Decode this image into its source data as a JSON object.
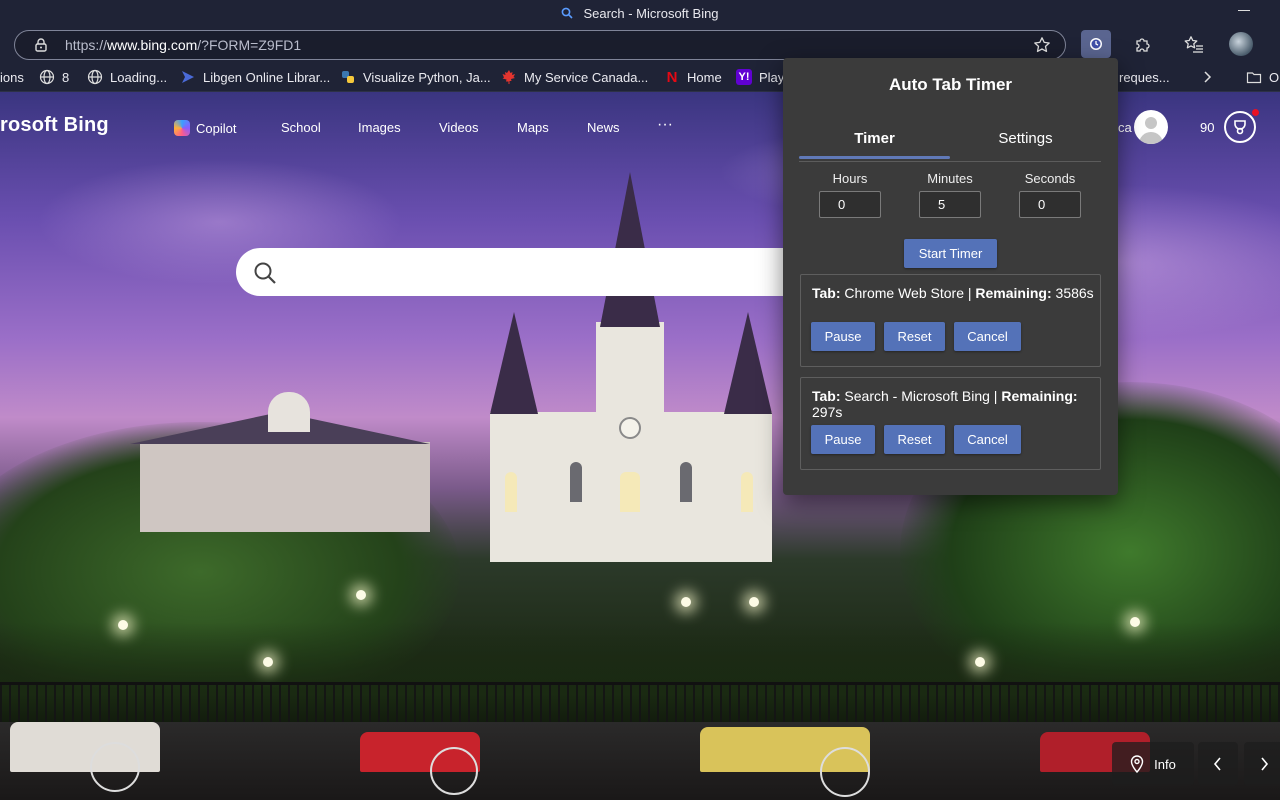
{
  "window": {
    "title": "Search - Microsoft Bing"
  },
  "address_bar": {
    "url_prefix": "https://",
    "url_host": "www.bing.com",
    "url_path": "/?FORM=Z9FD1"
  },
  "favorites": [
    {
      "label": "ions",
      "icon": ""
    },
    {
      "label": "8",
      "icon": "globe-icon"
    },
    {
      "label": "Loading...",
      "icon": "globe-icon"
    },
    {
      "label": "Libgen Online Librar...",
      "icon": "libgen-icon"
    },
    {
      "label": "Visualize Python, Ja...",
      "icon": "python-icon"
    },
    {
      "label": "My Service Canada...",
      "icon": "maple-leaf-icon"
    },
    {
      "label": "Home",
      "icon": "netflix-icon"
    },
    {
      "label": "Playe",
      "icon": "yahoo-icon"
    },
    {
      "label": "reques...",
      "icon": ""
    },
    {
      "label": "O",
      "icon": "folder-icon"
    }
  ],
  "bing": {
    "logo": "rosoft Bing",
    "nav": [
      "Copilot",
      "School",
      "Images",
      "Videos",
      "Maps",
      "News",
      "···"
    ],
    "user_name_fragment": "ca",
    "rewards_points": "90",
    "info_label": "Info"
  },
  "popup": {
    "title": "Auto Tab Timer",
    "tabs": [
      "Timer",
      "Settings"
    ],
    "fields": {
      "hours": {
        "label": "Hours",
        "value": "0"
      },
      "minutes": {
        "label": "Minutes",
        "value": "5"
      },
      "seconds": {
        "label": "Seconds",
        "value": "0"
      }
    },
    "start_label": "Start Timer",
    "tab_prefix": "Tab:",
    "remaining_prefix": "Remaining:",
    "timers": [
      {
        "tab": "Chrome Web Store",
        "remaining": "3586s"
      },
      {
        "tab": "Search - Microsoft Bing",
        "remaining": "297s"
      }
    ],
    "buttons": {
      "pause": "Pause",
      "reset": "Reset",
      "cancel": "Cancel"
    }
  },
  "colors": {
    "accent": "#5472b8",
    "popup_bg": "#3b3b3b",
    "chrome_bg": "#1f2336"
  }
}
